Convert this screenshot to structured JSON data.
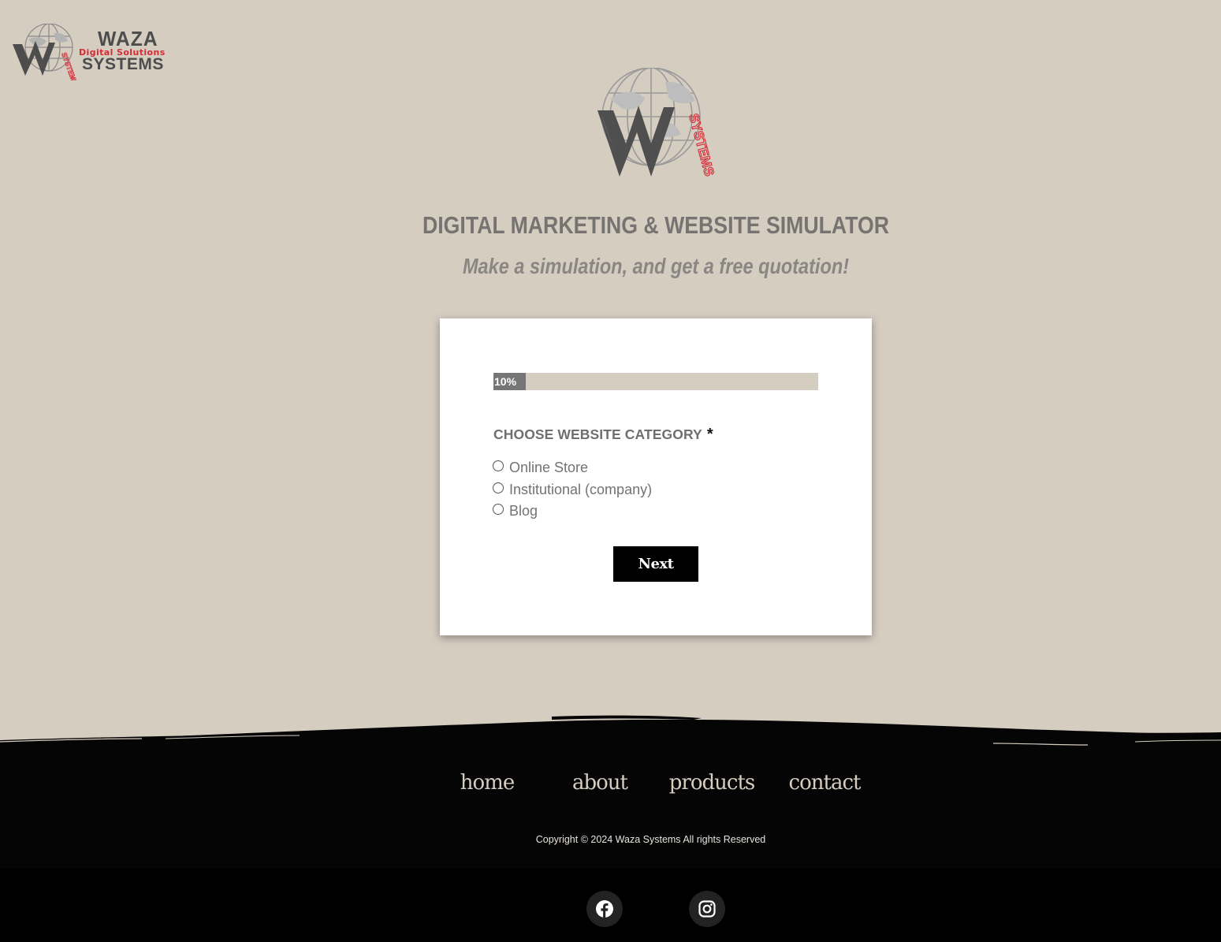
{
  "brand": {
    "name": "WAZA",
    "tagline": "Digital Solutions",
    "name_line2": "SYSTEMS",
    "logo_badge": "SYSTEMS"
  },
  "hero": {
    "title": "DIGITAL MARKETING & WEBSITE SIMULATOR",
    "subtitle": "Make a simulation, and get a free quotation!"
  },
  "form": {
    "progress_value": 0.1,
    "progress_label": "10%",
    "field_label": "CHOOSE WEBSITE CATEGORY",
    "required_mark": "*",
    "options": [
      "Online Store",
      "Institutional (company)",
      "Blog"
    ],
    "next_label": "Next"
  },
  "footer": {
    "nav": [
      "home",
      "about",
      "products",
      "contact"
    ],
    "copyright": "Copyright © 2024 Waza Systems All rights Reserved",
    "social": [
      "facebook-icon",
      "instagram-icon"
    ]
  },
  "colors": {
    "background": "#d6cdc1",
    "heading": "#767370",
    "brand_red": "#d62a35",
    "footer": "#050505"
  }
}
